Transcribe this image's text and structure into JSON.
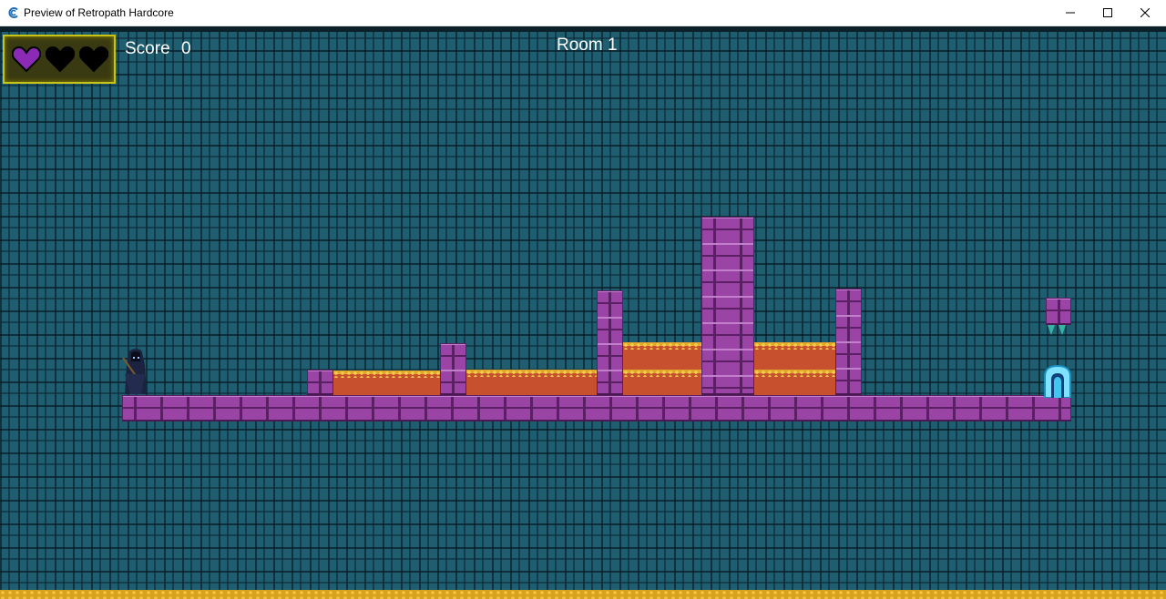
{
  "window": {
    "title": "Preview of Retropath Hardcore",
    "icon": "construct-app-icon",
    "controls": [
      "minimize-icon",
      "maximize-icon",
      "close-icon"
    ]
  },
  "hud": {
    "hearts": {
      "total": 3,
      "filled": 1,
      "filled_color": "#8b2bb5",
      "empty_color": "#000000"
    },
    "score_label": "Score",
    "score_value": "0",
    "room_label": "Room 1"
  },
  "colors": {
    "background": "#1e5e70",
    "brick": "#9a44a6",
    "lava": "#c7502f",
    "lava_crust": "#e2a62a",
    "door": "#3fc7ef",
    "hud_border": "#c9c316"
  }
}
